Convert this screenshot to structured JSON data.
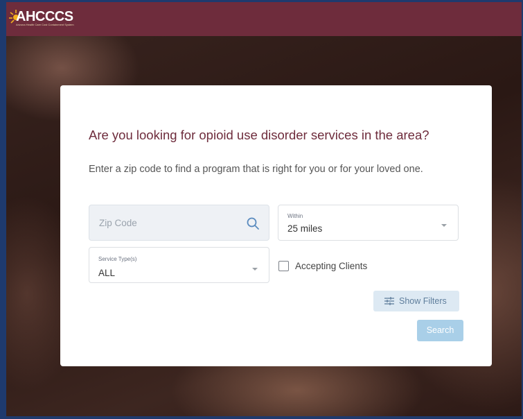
{
  "header": {
    "logo_text": "AHCCCS",
    "logo_tagline": "Arizona Health Care Cost Containment System"
  },
  "card": {
    "heading": "Are you looking for opioid use disorder services in the area?",
    "subtext": "Enter a zip code to find a program that is right for you or for your loved one."
  },
  "zip": {
    "placeholder": "Zip Code",
    "icon": "search-icon"
  },
  "within": {
    "label": "Within",
    "value": "25 miles",
    "icon": "chevron-down-icon"
  },
  "service_type": {
    "label": "Service Type(s)",
    "value": "ALL",
    "icon": "chevron-down-icon"
  },
  "accepting": {
    "label": "Accepting Clients",
    "checked": false
  },
  "buttons": {
    "show_filters": "Show Filters",
    "show_filters_icon": "sliders-icon",
    "search": "Search"
  },
  "colors": {
    "brand": "#6e2c3c",
    "accent_button": "#a9cfe8",
    "filters_button": "#dde9f3"
  }
}
